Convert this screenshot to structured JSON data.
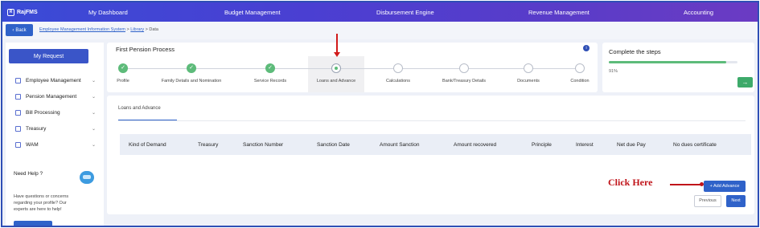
{
  "app": {
    "logo_text": "RajFMS",
    "logo_badge": "R"
  },
  "topnav": {
    "items": [
      {
        "label": "My Dashboard"
      },
      {
        "label": "Budget Management"
      },
      {
        "label": "Disbursement Engine"
      },
      {
        "label": "Revenue Management"
      },
      {
        "label": "Accounting"
      }
    ]
  },
  "breadcrumb": {
    "back_label": "Back",
    "items": [
      "Employee Management Information System",
      "Library",
      "Data"
    ],
    "separator": ">"
  },
  "sidebar": {
    "my_request_label": "My Request",
    "items": [
      {
        "label": "Employee Management"
      },
      {
        "label": "Pension Management"
      },
      {
        "label": "Bill Processing"
      },
      {
        "label": "Treasury"
      },
      {
        "label": "WAM"
      }
    ],
    "help": {
      "title": "Need Help ?",
      "text": "Have questions or concerns regarding your profile? Our experts are here to help!"
    }
  },
  "process": {
    "title": "First Pension Process",
    "steps": [
      {
        "label": "Profile",
        "status": "done"
      },
      {
        "label": "Family Details and Nomination",
        "status": "done"
      },
      {
        "label": "Service Records",
        "status": "done"
      },
      {
        "label": "Loans and Advance",
        "status": "active"
      },
      {
        "label": "Calculations",
        "status": "todo"
      },
      {
        "label": "Bank/Treasury Details",
        "status": "todo"
      },
      {
        "label": "Documents",
        "status": "todo"
      },
      {
        "label": "Condition",
        "status": "todo"
      }
    ]
  },
  "complete": {
    "title": "Complete the steps",
    "progress_fraction": 0.91,
    "progress_text": "91%"
  },
  "main": {
    "tab_label": "Loans and Advance",
    "columns": [
      "Kind of Demand",
      "Treasury",
      "Sanction Number",
      "Sanction Date",
      "Amount Sanction",
      "Amount recovered",
      "Principle",
      "Interest",
      "Net due Pay",
      "No dues certificate"
    ],
    "add_button_label": "+ Add Advance",
    "previous_label": "Previous",
    "next_label": "Next"
  },
  "annotation": {
    "text": "Click Here"
  },
  "colors": {
    "nav_start": "#3a4bd6",
    "nav_end": "#6b3bc3",
    "primary": "#2f62c9",
    "success": "#5dbb7a",
    "annotation": "#c0141a"
  }
}
